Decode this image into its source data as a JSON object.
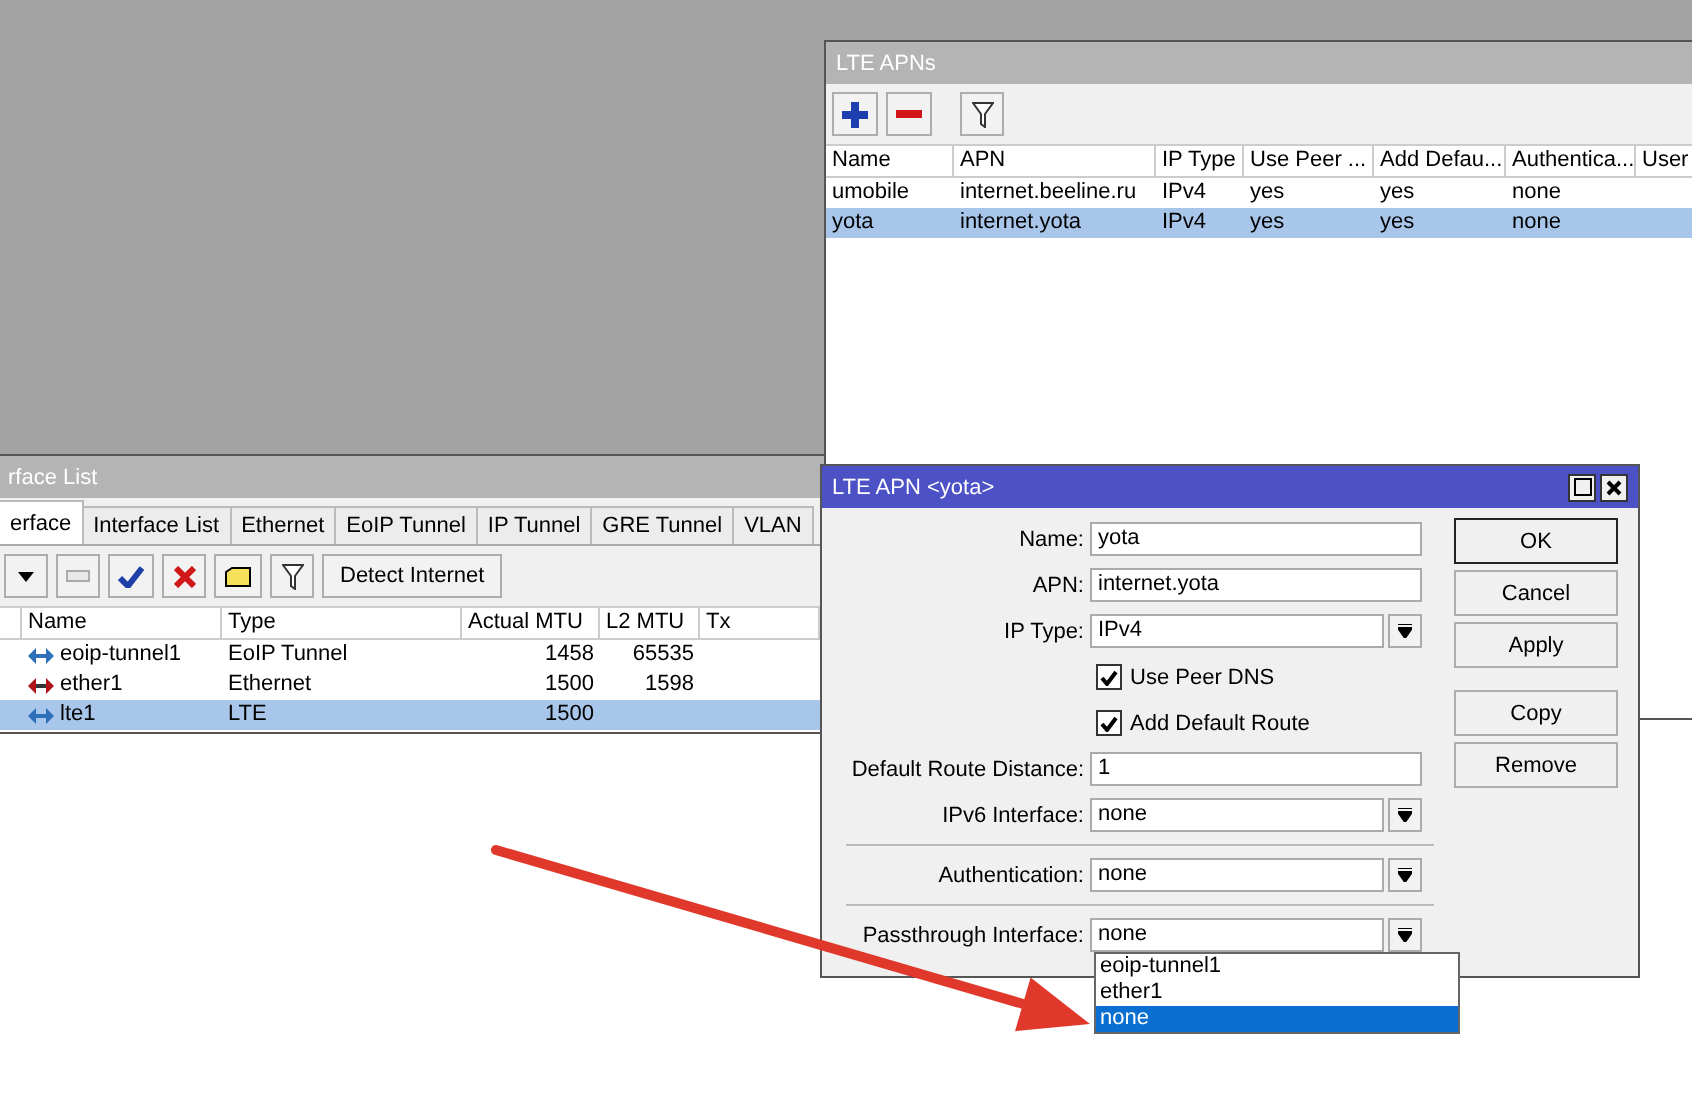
{
  "interface_list": {
    "title": "rface List",
    "tabs": [
      {
        "label": "erface",
        "selected": true
      },
      {
        "label": "Interface List",
        "selected": false
      },
      {
        "label": "Ethernet",
        "selected": false
      },
      {
        "label": "EoIP Tunnel",
        "selected": false
      },
      {
        "label": "IP Tunnel",
        "selected": false
      },
      {
        "label": "GRE Tunnel",
        "selected": false
      },
      {
        "label": "VLAN",
        "selected": false
      }
    ],
    "detect_button": "Detect Internet",
    "columns": [
      "Name",
      "Type",
      "Actual MTU",
      "L2 MTU",
      "Tx"
    ],
    "rows": [
      {
        "kind": "tunnel",
        "cells": [
          "eoip-tunnel1",
          "EoIP Tunnel",
          "1458",
          "65535"
        ],
        "selected": false
      },
      {
        "kind": "ethernet",
        "cells": [
          "ether1",
          "Ethernet",
          "1500",
          "1598"
        ],
        "selected": false
      },
      {
        "kind": "tunnel",
        "cells": [
          "lte1",
          "LTE",
          "1500"
        ],
        "selected": true
      }
    ]
  },
  "apn_list": {
    "title": "LTE APNs",
    "columns": [
      "Name",
      "APN",
      "IP Type",
      "Use Peer ...",
      "Add Defau...",
      "Authentica...",
      "User"
    ],
    "rows": [
      {
        "cells": [
          "umobile",
          "internet.beeline.ru",
          "IPv4",
          "yes",
          "yes",
          "none"
        ],
        "selected": false
      },
      {
        "cells": [
          "yota",
          "internet.yota",
          "IPv4",
          "yes",
          "yes",
          "none"
        ],
        "selected": true
      }
    ]
  },
  "apn_dialog": {
    "title": "LTE APN <yota>",
    "fields": [
      {
        "kind": "text",
        "label": "Name:",
        "value": "yota"
      },
      {
        "kind": "text",
        "label": "APN:",
        "value": "internet.yota"
      },
      {
        "kind": "select",
        "label": "IP Type:",
        "value": "IPv4"
      },
      {
        "kind": "checkbox",
        "label": "Use Peer DNS",
        "checked": true
      },
      {
        "kind": "checkbox",
        "label": "Add Default Route",
        "checked": true
      },
      {
        "kind": "text",
        "label": "Default Route Distance:",
        "value": "1"
      },
      {
        "kind": "select",
        "label": "IPv6 Interface:",
        "value": "none"
      },
      {
        "kind": "separator"
      },
      {
        "kind": "select",
        "label": "Authentication:",
        "value": "none"
      },
      {
        "kind": "separator"
      },
      {
        "kind": "select",
        "label": "Passthrough Interface:",
        "value": "none"
      }
    ],
    "button_groups": [
      [
        "OK",
        "Cancel",
        "Apply"
      ],
      [
        "Copy",
        "Remove"
      ]
    ]
  },
  "dropdown": {
    "options": [
      {
        "label": "eoip-tunnel1",
        "selected": false
      },
      {
        "label": "ether1",
        "selected": false
      },
      {
        "label": "none",
        "selected": true
      }
    ]
  }
}
